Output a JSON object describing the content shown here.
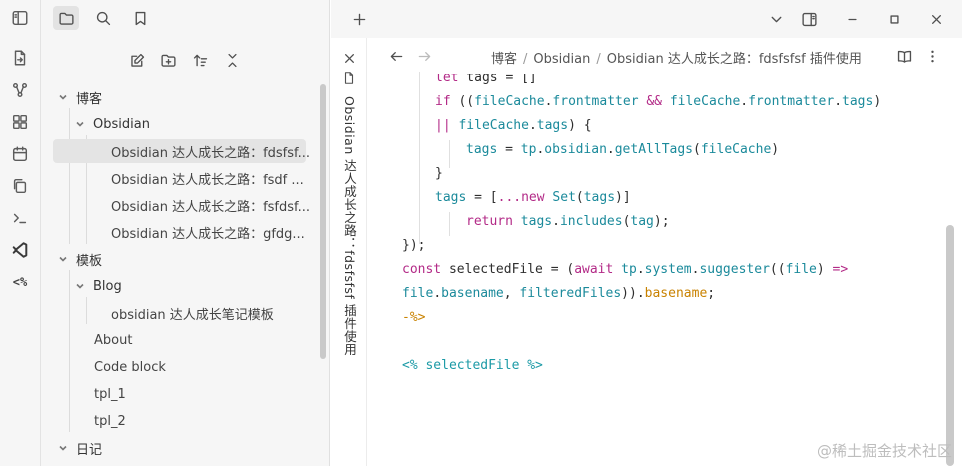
{
  "ribbon": {
    "icons": [
      "file-arrow-icon",
      "graph-icon",
      "grid-icon",
      "calendar-icon",
      "copy-icon",
      "terminal-icon",
      "vscode-icon",
      "code-tag-icon"
    ],
    "code_tag_label": "<%"
  },
  "sidebar": {
    "tree": [
      {
        "label": "博客"
      },
      {
        "label": "Obsidian"
      },
      {
        "label": "Obsidian 达人成长之路：fdsfsf..."
      },
      {
        "label": "Obsidian 达人成长之路：fsdf ..."
      },
      {
        "label": "Obsidian 达人成长之路：fsfdsf..."
      },
      {
        "label": "Obsidian 达人成长之路：gfdg..."
      },
      {
        "label": "模板"
      },
      {
        "label": "Blog"
      },
      {
        "label": "obsidian 达人成长笔记模板"
      },
      {
        "label": "About"
      },
      {
        "label": "Code block"
      },
      {
        "label": "tpl_1"
      },
      {
        "label": "tpl_2"
      },
      {
        "label": "日记"
      }
    ]
  },
  "editor": {
    "tab_title": "Obsidian 达人成长之路：fdsfsfsf 插件使用",
    "breadcrumb": [
      "博客",
      "Obsidian",
      "Obsidian 达人成长之路：fdsfsfsf 插件使用"
    ],
    "separator": "/",
    "code": {
      "l1_let": "let",
      "l1_rest": " tags = []",
      "l2_if": "if",
      "l2_a": " ((",
      "l2_b": "fileCache",
      "l2_c": ".",
      "l2_d": "frontmatter",
      "l2_e": " && ",
      "l2_f": "fileCache",
      "l2_g": ".",
      "l2_h": "frontmatter",
      "l2_i": ".",
      "l2_j": "tags",
      "l2_k": ")",
      "l3_or": "||",
      "l3_a": " ",
      "l3_b": "fileCache",
      "l3_c": ".",
      "l3_d": "tags",
      "l3_e": ") {",
      "l4_a": "tags",
      "l4_b": " = ",
      "l4_c": "tp",
      "l4_d": ".",
      "l4_e": "obsidian",
      "l4_f": ".",
      "l4_g": "getAllTags",
      "l4_h": "(",
      "l4_i": "fileCache",
      "l4_j": ")",
      "l5": "}",
      "l6_a": "tags",
      "l6_b": " = [",
      "l6_c": "...",
      "l6_d": "new",
      "l6_e": " ",
      "l6_f": "Set",
      "l6_g": "(",
      "l6_h": "tags",
      "l6_i": ")]",
      "l7_a": "return",
      "l7_b": " ",
      "l7_c": "tags",
      "l7_d": ".",
      "l7_e": "includes",
      "l7_f": "(",
      "l7_g": "tag",
      "l7_h": ");",
      "l8": "});",
      "l9_a": "const",
      "l9_b": " selectedFile = (",
      "l9_c": "await",
      "l9_d": " ",
      "l9_e": "tp",
      "l9_f": ".",
      "l9_g": "system",
      "l9_h": ".",
      "l9_i": "suggester",
      "l9_j": "((",
      "l9_k": "file",
      "l9_l": ") ",
      "l9_m": "=>",
      "l10_a": "file",
      "l10_b": ".",
      "l10_c": "basename",
      "l10_d": ", ",
      "l10_e": "filteredFiles",
      "l10_f": "))",
      "l10_g": ".",
      "l10_h": "basename",
      "l10_i": ";",
      "l11": "-%>",
      "l12": "<% selectedFile %>"
    }
  },
  "watermark": "@稀土掘金技术社区"
}
